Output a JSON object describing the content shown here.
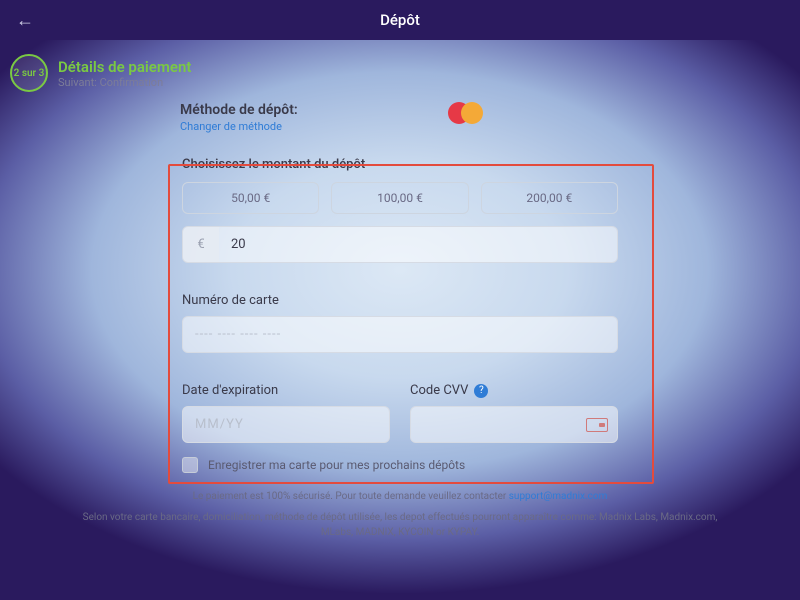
{
  "topbar": {
    "title": "Dépôt"
  },
  "step": {
    "badge": "2 sur 3",
    "title": "Détails de paiement",
    "subtitle": "Suivant: Confirmation"
  },
  "method": {
    "label": "Méthode de dépôt:",
    "change": "Changer de méthode"
  },
  "amount": {
    "title": "Choisissez le montant du dépôt",
    "options": [
      "50,00 €",
      "100,00 €",
      "200,00 €"
    ],
    "currency": "€",
    "value": "20"
  },
  "card": {
    "number_label": "Numéro de carte",
    "number_placeholder": "---- ---- ---- ----",
    "expiry_label": "Date d'expiration",
    "expiry_placeholder": "MM/YY",
    "cvv_label": "Code CVV"
  },
  "save_card": "Enregistrer ma carte pour mes prochains dépôts",
  "footer": {
    "secure_prefix": "Le paiement est 100% sécurisé. Pour toute demande veuillez contacter ",
    "support_email": "support@madnix.com",
    "disclaimer": "Selon votre carte bancaire, domiciliation, méthode de dépôt utilisée, les depot effectués pourront apparaître comme: Madnix Labs, Madnix.com, MLabs, MADNIX, KYCOIN or KYPAY."
  }
}
